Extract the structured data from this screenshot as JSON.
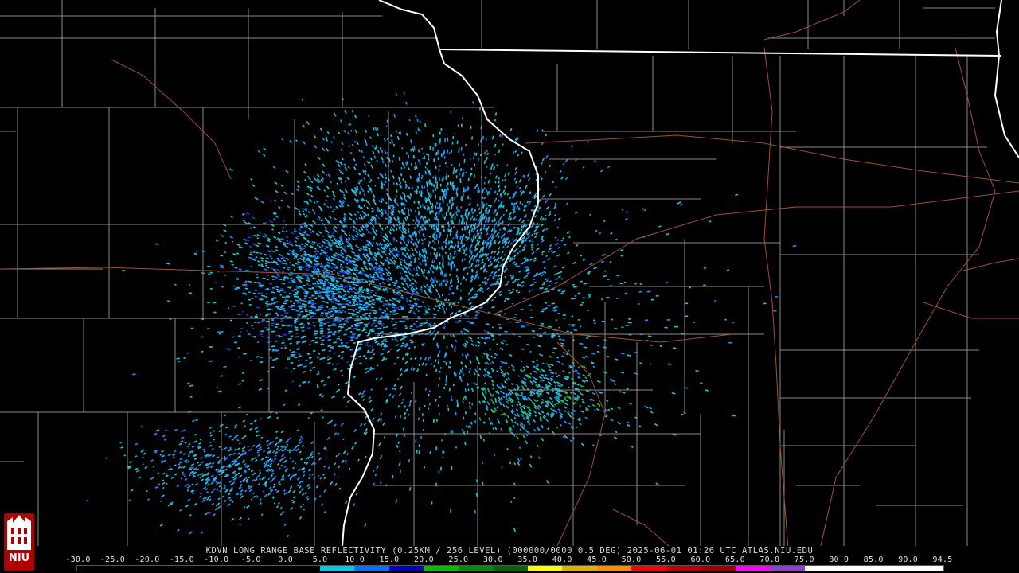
{
  "caption": "KDVN LONG RANGE BASE REFLECTIVITY (0.25KM / 256 LEVEL) (000000/0000 0.5 DEG) 2025-06-01 01:26 UTC  ATLAS.NIU.EDU",
  "scale_ticks": [
    "-30.0",
    "-25.0",
    "-20.0",
    "-15.0",
    "-10.0",
    "-5.0",
    "0.0",
    "5.0",
    "10.0",
    "15.0",
    "20.0",
    "25.0",
    "30.0",
    "35.0",
    "40.0",
    "45.0",
    "50.0",
    "55.0",
    "60.0",
    "65.0",
    "70.0",
    "75.0",
    "80.0",
    "85.0",
    "90.0",
    "94.5"
  ],
  "scale_colors": [
    "#000000",
    "#000000",
    "#000000",
    "#000000",
    "#000000",
    "#000000",
    "#000000",
    "#00c8e8",
    "#0070ff",
    "#0000c0",
    "#00c000",
    "#009000",
    "#006800",
    "#ffff00",
    "#e0b000",
    "#ff8c00",
    "#ff0000",
    "#c00000",
    "#a00000",
    "#ff00ff",
    "#9040d0",
    "#ffffff",
    "#ffffff",
    "#ffffff",
    "#ffffff"
  ],
  "logo_text": "NIU",
  "colors": {
    "county_lines": "#8a8a8a",
    "state_lines": "#ffffff",
    "highways": "#a0522d",
    "echo_light": "#22c4d8",
    "echo_mid": "#1e90ff",
    "echo_dark": "#1c3fd0",
    "echo_green": "#1fbf3f"
  }
}
